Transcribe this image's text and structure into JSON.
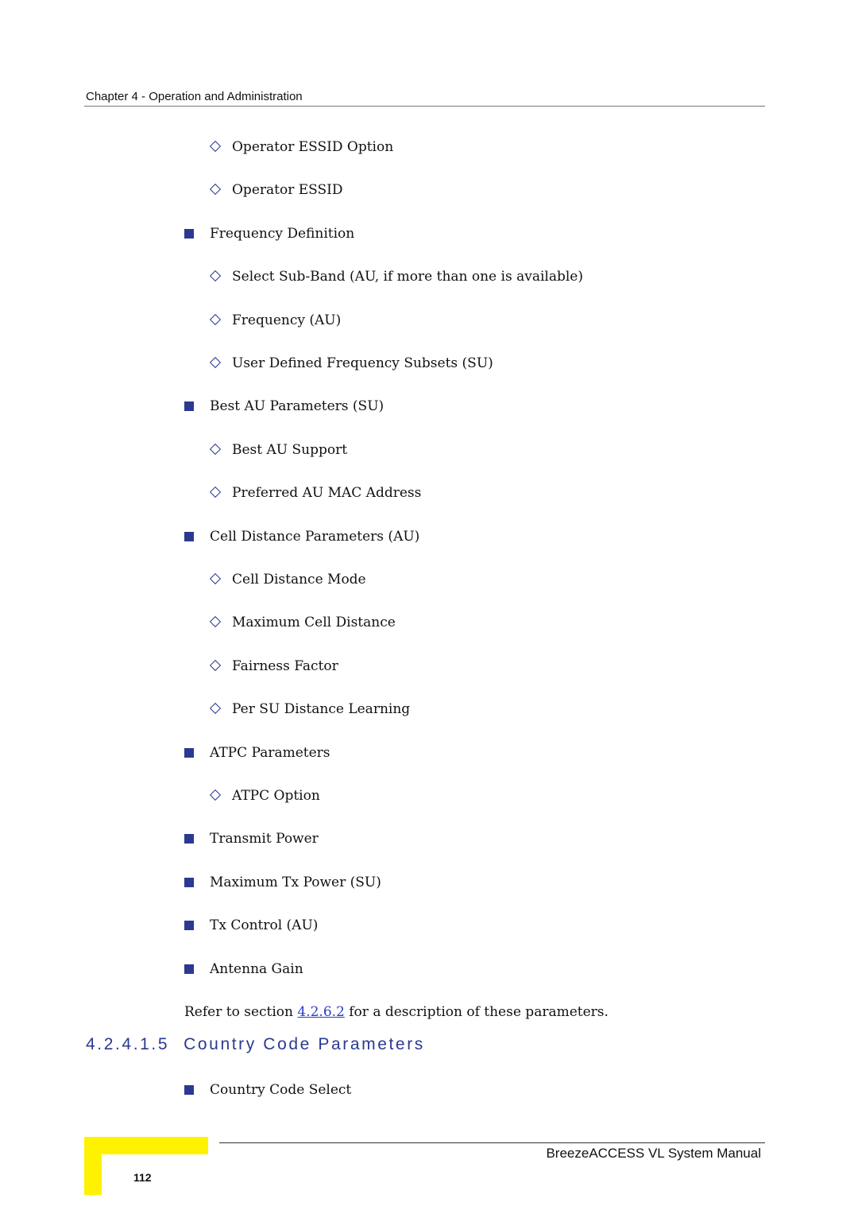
{
  "header": {
    "chapter": "Chapter 4 - Operation and Administration"
  },
  "items": [
    {
      "level": 2,
      "text": "Operator ESSID Option"
    },
    {
      "level": 2,
      "text": "Operator ESSID"
    },
    {
      "level": 1,
      "text": "Frequency Definition"
    },
    {
      "level": 2,
      "text": "Select Sub-Band (AU, if more than one is available)"
    },
    {
      "level": 2,
      "text": "Frequency (AU)"
    },
    {
      "level": 2,
      "text": "User Defined Frequency Subsets (SU)"
    },
    {
      "level": 1,
      "text": "Best AU Parameters (SU)"
    },
    {
      "level": 2,
      "text": "Best AU Support"
    },
    {
      "level": 2,
      "text": "Preferred AU MAC Address"
    },
    {
      "level": 1,
      "text": "Cell Distance Parameters (AU)"
    },
    {
      "level": 2,
      "text": "Cell Distance Mode"
    },
    {
      "level": 2,
      "text": "Maximum Cell Distance"
    },
    {
      "level": 2,
      "text": "Fairness Factor"
    },
    {
      "level": 2,
      "text": "Per SU Distance Learning"
    },
    {
      "level": 1,
      "text": "ATPC Parameters"
    },
    {
      "level": 2,
      "text": "ATPC Option"
    },
    {
      "level": 1,
      "text": "Transmit Power"
    },
    {
      "level": 1,
      "text": "Maximum Tx Power (SU)"
    },
    {
      "level": 1,
      "text": "Tx Control (AU)"
    },
    {
      "level": 1,
      "text": "Antenna Gain"
    }
  ],
  "refer": {
    "before": "Refer to section ",
    "link": "4.2.6.2",
    "after": " for a description of these parameters."
  },
  "section": {
    "number": "4.2.4.1.5",
    "title": "Country Code Parameters"
  },
  "section_items": [
    {
      "level": 1,
      "text": "Country Code Select"
    }
  ],
  "footer": {
    "title": "BreezeACCESS VL System Manual",
    "page": "112"
  },
  "colors": {
    "bullet": "#2b3990",
    "heading": "#2b3990",
    "link": "#2a3ec8",
    "tab": "#fff200"
  }
}
